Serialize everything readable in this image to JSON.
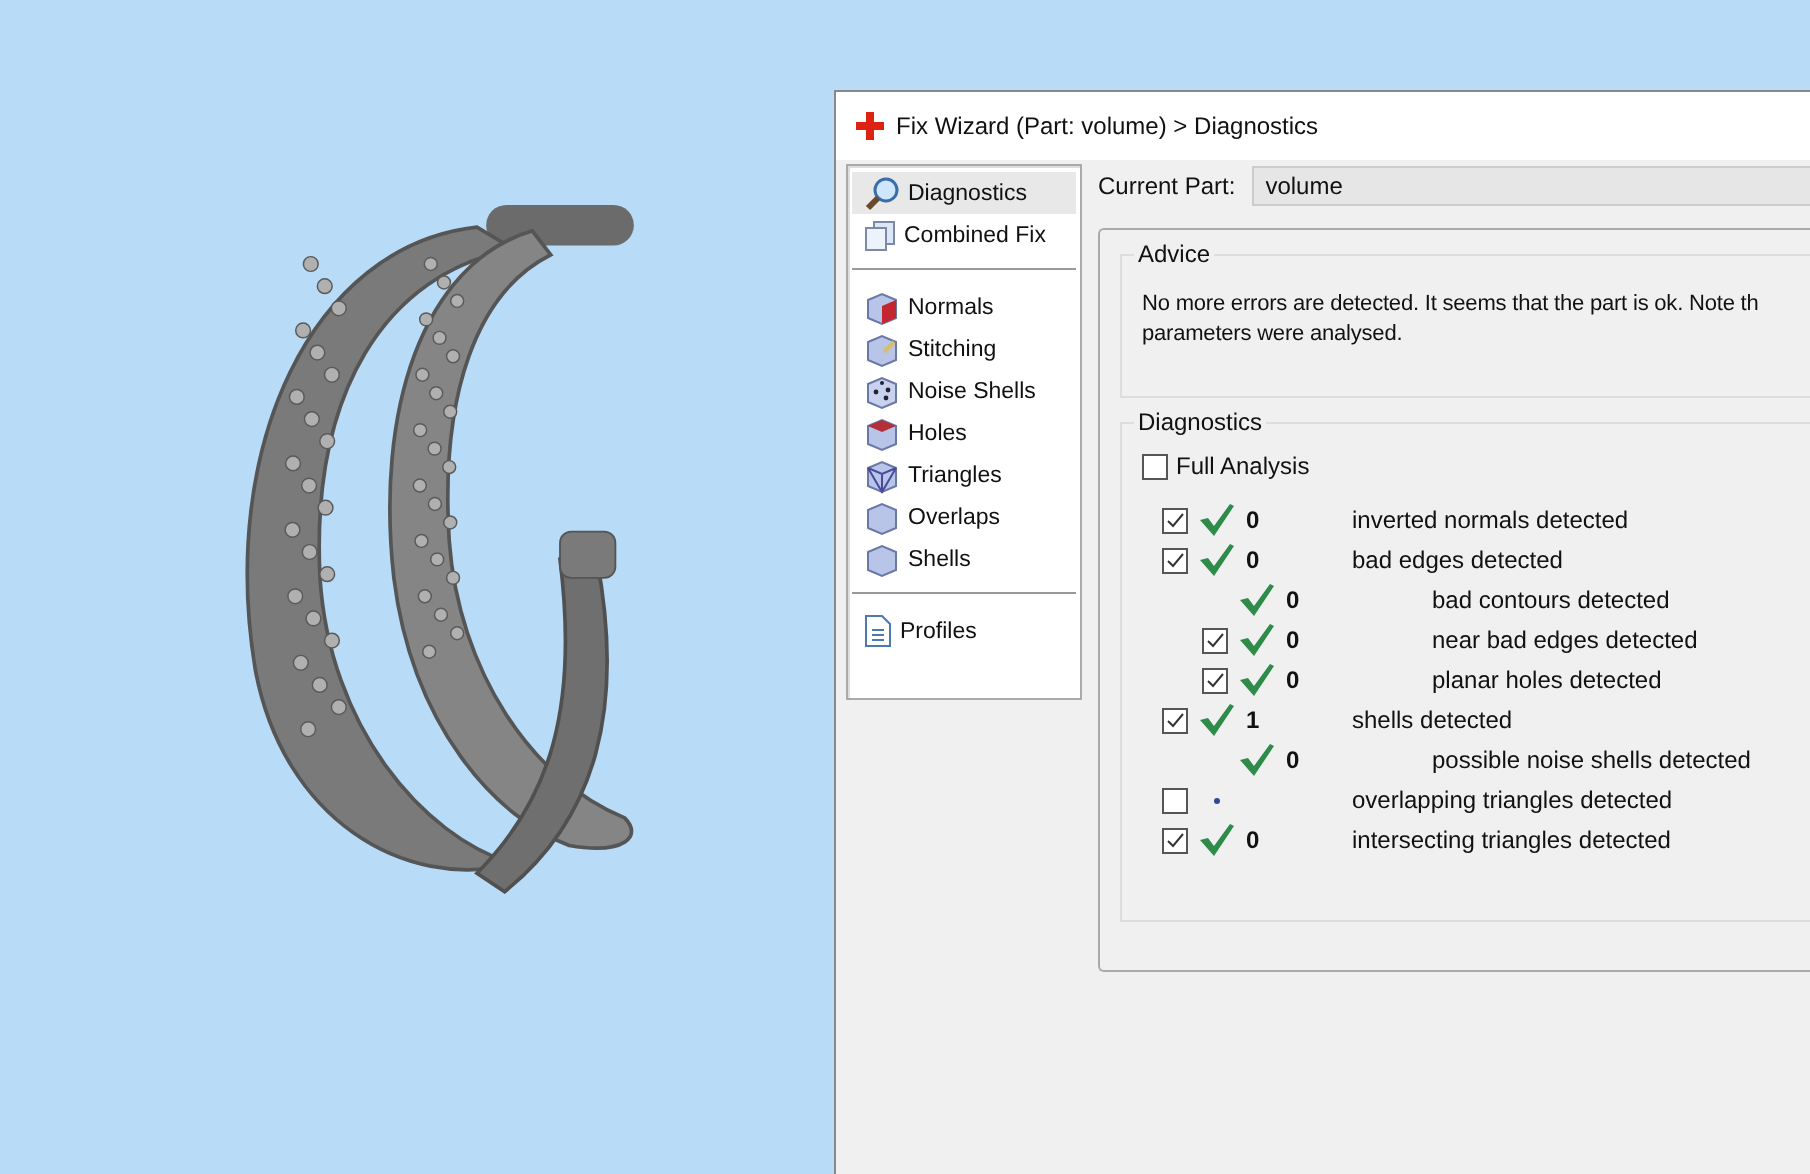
{
  "window": {
    "title": "Fix Wizard (Part: volume) > Diagnostics"
  },
  "sidebar": {
    "groups": [
      {
        "items": [
          {
            "label": "Diagnostics",
            "selected": true
          },
          {
            "label": "Combined Fix",
            "selected": false
          }
        ]
      },
      {
        "items": [
          {
            "label": "Normals",
            "selected": false
          },
          {
            "label": "Stitching",
            "selected": false
          },
          {
            "label": "Noise Shells",
            "selected": false
          },
          {
            "label": "Holes",
            "selected": false
          },
          {
            "label": "Triangles",
            "selected": false
          },
          {
            "label": "Overlaps",
            "selected": false
          },
          {
            "label": "Shells",
            "selected": false
          }
        ]
      },
      {
        "items": [
          {
            "label": "Profiles",
            "selected": false
          }
        ]
      }
    ]
  },
  "current_part": {
    "label": "Current Part:",
    "value": "volume"
  },
  "advice": {
    "title": "Advice",
    "text": "No more errors are detected. It seems that the part is ok. Note th",
    "text_line_2": "parameters were analysed."
  },
  "diagnostics": {
    "title": "Diagnostics",
    "full_analysis": {
      "label": "Full Analysis",
      "checked": false
    },
    "rows": [
      {
        "kind": "check",
        "checked": true,
        "passed": true,
        "count": "0",
        "label": "inverted normals detected"
      },
      {
        "kind": "check",
        "checked": true,
        "passed": true,
        "count": "0",
        "label": "bad edges detected",
        "children": [
          {
            "kind": "plain",
            "passed": true,
            "count": "0",
            "label": "bad contours detected"
          },
          {
            "kind": "check",
            "checked": true,
            "passed": true,
            "count": "0",
            "label": "near bad edges detected"
          },
          {
            "kind": "check",
            "checked": true,
            "passed": true,
            "count": "0",
            "label": "planar holes detected"
          }
        ]
      },
      {
        "kind": "check",
        "checked": true,
        "passed": true,
        "count": "1",
        "label": "shells detected",
        "children": [
          {
            "kind": "plain",
            "passed": true,
            "count": "0",
            "label": "possible noise shells detected"
          }
        ]
      },
      {
        "kind": "check",
        "checked": false,
        "passed": false,
        "label": "overlapping triangles detected"
      },
      {
        "kind": "check",
        "checked": true,
        "passed": true,
        "count": "0",
        "label": "intersecting triangles detected"
      }
    ]
  }
}
